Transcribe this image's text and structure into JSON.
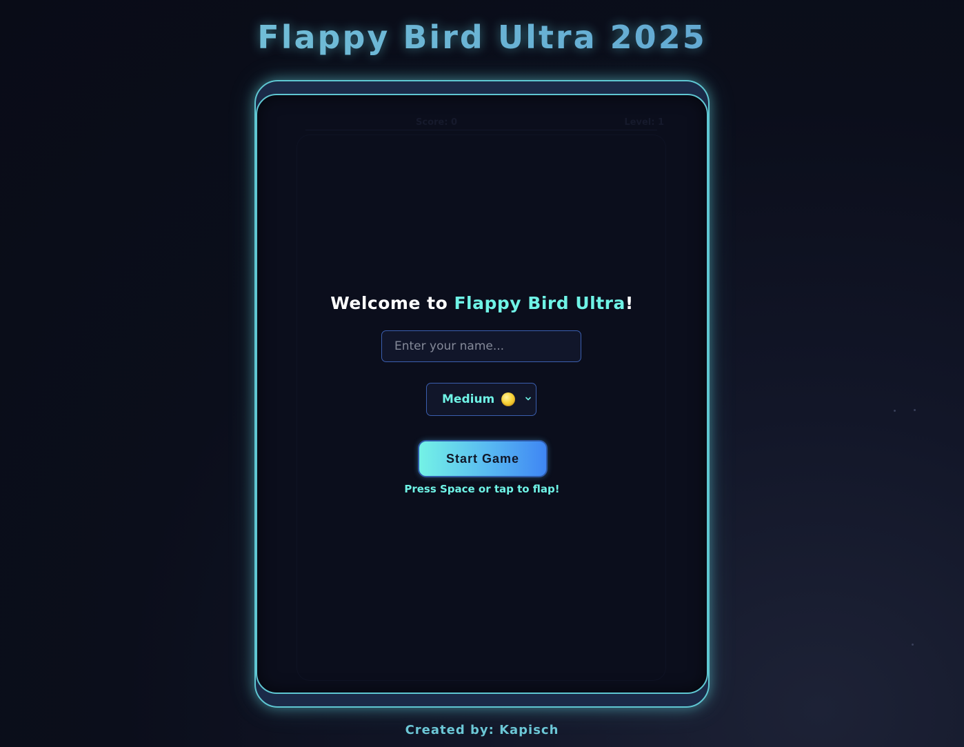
{
  "header": {
    "title": "Flappy Bird Ultra 2025"
  },
  "hud": {
    "score_label": "Score: 0",
    "level_label": "Level: 1"
  },
  "menu": {
    "welcome_prefix": "Welcome to ",
    "welcome_accent": "Flappy Bird Ultra",
    "welcome_suffix": "!",
    "name_placeholder": "Enter your name...",
    "name_value": "",
    "difficulty_selected": "Medium",
    "difficulty_icon": "yellow-circle-icon",
    "start_button_label": "Start Game",
    "hint": "Press Space or tap to flap!"
  },
  "footer": {
    "credit": "Created by: Kapisch"
  },
  "colors": {
    "accent": "#6ff3e6",
    "frame_border": "#5fc7d2",
    "input_border": "#3b5fb0",
    "background": "#0b0e1b",
    "button_gradient_start": "#74f2e6",
    "button_gradient_end": "#3f86f3"
  }
}
